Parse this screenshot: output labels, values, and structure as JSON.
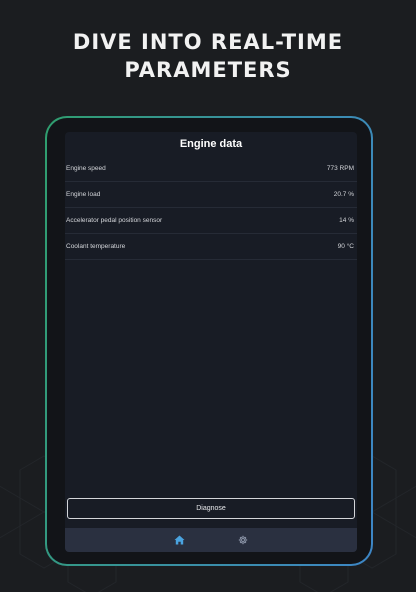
{
  "headline": {
    "line1": "DIVE INTO REAL-TIME",
    "line2": "PARAMETERS"
  },
  "screen": {
    "title": "Engine data",
    "rows": [
      {
        "label": "Engine speed",
        "value": "773 RPM"
      },
      {
        "label": "Engine load",
        "value": "20.7 %"
      },
      {
        "label": "Accelerator pedal position sensor",
        "value": "14 %"
      },
      {
        "label": "Coolant temperature",
        "value": "90 °C"
      }
    ],
    "diagnose_label": "Diagnose"
  },
  "tabbar": {
    "tabs": [
      {
        "icon": "home-icon",
        "active": true
      },
      {
        "icon": "settings-gear-icon",
        "active": false
      }
    ]
  },
  "colors": {
    "background": "#1b1d20",
    "frame_start": "#2f9e6e",
    "frame_end": "#3d86c6",
    "screen": "#181c25",
    "tabbar": "#2a3040",
    "active_icon": "#4aa3df",
    "inactive_icon": "#8a93a6"
  }
}
